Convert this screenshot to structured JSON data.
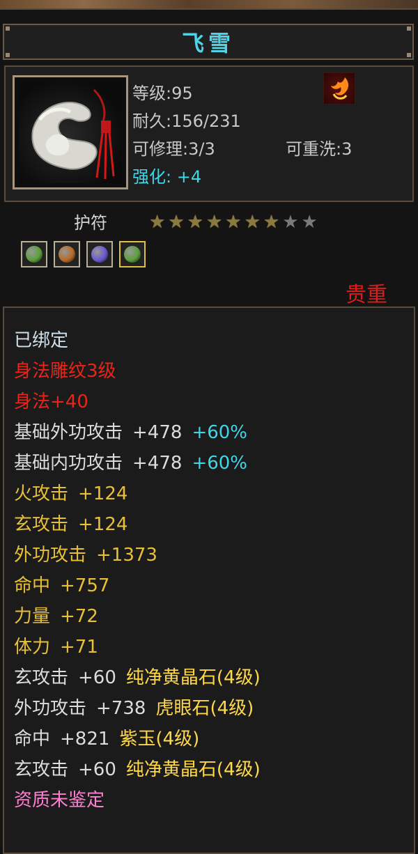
{
  "item": {
    "name": "飞雪",
    "level": "等级:95",
    "durability": "耐久:156/231",
    "repairable": "可修理:3/3",
    "rewashable": "可重洗:3",
    "enhance": "强化: +4",
    "type": "护符",
    "stars_filled": 7,
    "stars_total": 9,
    "rarity": "贵重"
  },
  "gems": [
    {
      "icon": "green-gem-icon",
      "color": "#5aa03a",
      "selected": false
    },
    {
      "icon": "amber-gem-icon",
      "color": "#b86a28",
      "selected": false
    },
    {
      "icon": "purple-gem-icon",
      "color": "#6a5ad0",
      "selected": false
    },
    {
      "icon": "green-gem-icon",
      "color": "#5aa03a",
      "selected": true
    }
  ],
  "props": {
    "bound": "已绑定",
    "engrave_name": "身法雕纹3级",
    "engrave_value": "身法+40",
    "base_ext_label": "基础外功攻击",
    "base_ext_value": "+478",
    "base_ext_pct": "+60%",
    "base_int_label": "基础内功攻击",
    "base_int_value": "+478",
    "base_int_pct": "+60%",
    "fire_label": "火攻击",
    "fire_value": "+124",
    "xuan_label": "玄攻击",
    "xuan_value": "+124",
    "ext_label": "外功攻击",
    "ext_value": "+1373",
    "hit_label": "命中",
    "hit_value": "+757",
    "str_label": "力量",
    "str_value": "+72",
    "vit_label": "体力",
    "vit_value": "+71",
    "gem1_stat": "玄攻击",
    "gem1_value": "+60",
    "gem1_name": "纯净黄晶石(4级)",
    "gem2_stat": "外功攻击",
    "gem2_value": "+738",
    "gem2_name": "虎眼石(4级)",
    "gem3_stat": "命中",
    "gem3_value": "+821",
    "gem3_name": "紫玉(4级)",
    "gem4_stat": "玄攻击",
    "gem4_value": "+60",
    "gem4_name": "纯净黄晶石(4级)",
    "quality": "资质未鉴定"
  }
}
